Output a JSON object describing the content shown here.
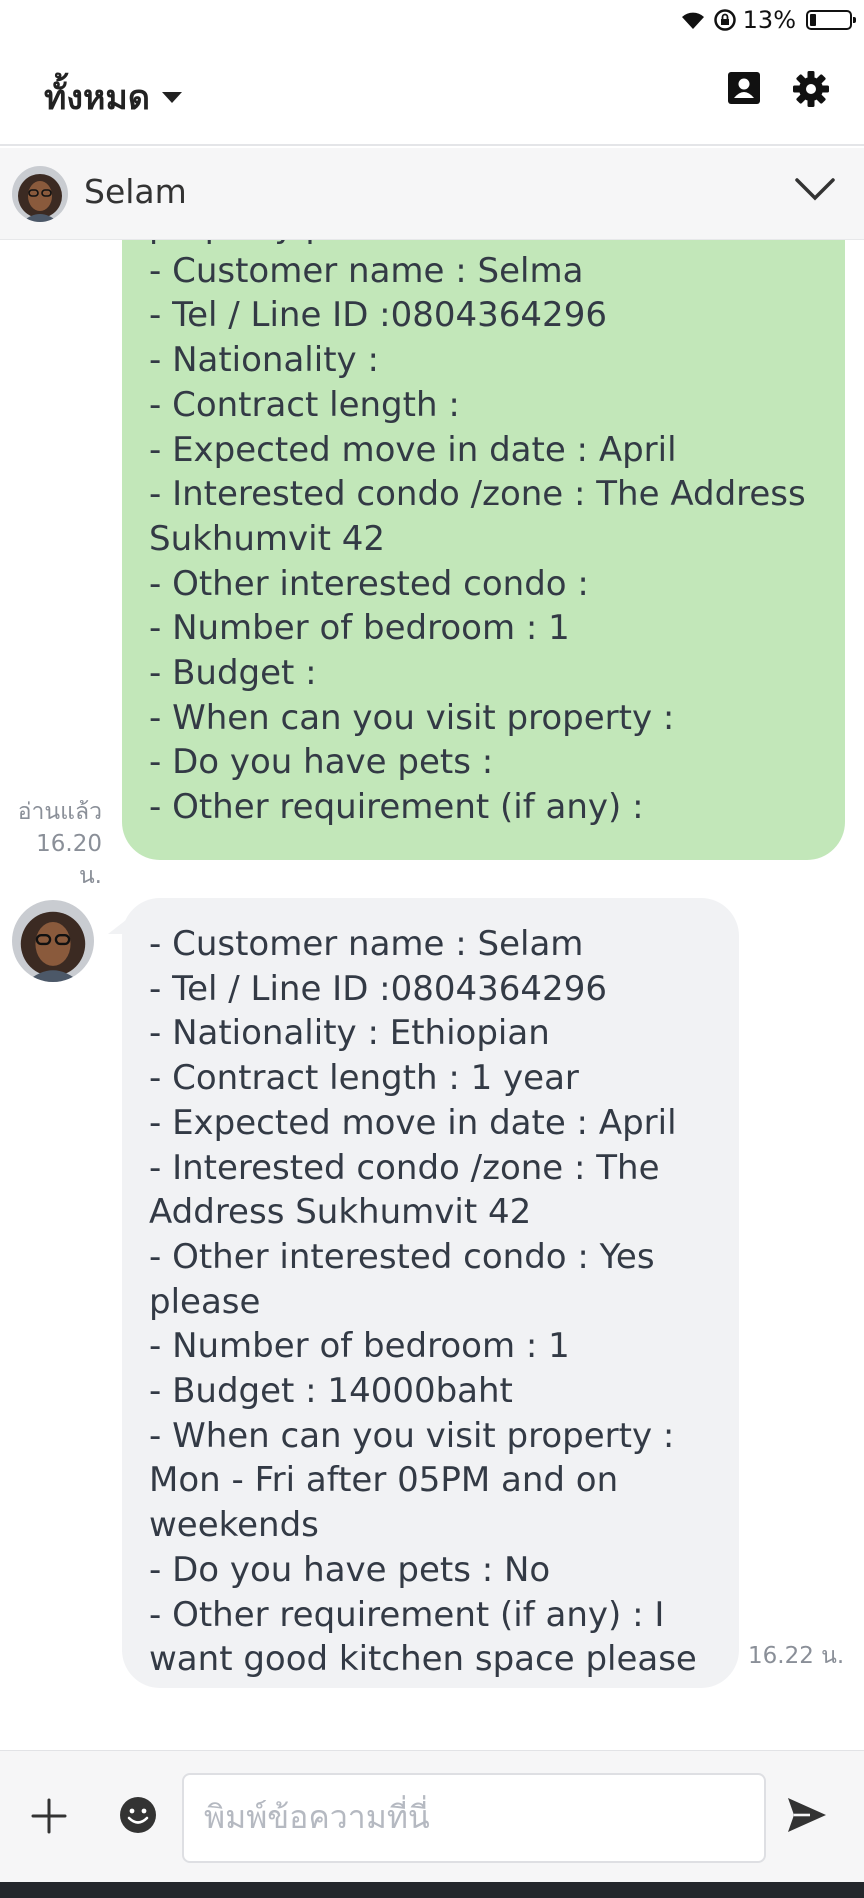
{
  "status_bar": {
    "battery": "13%",
    "icons": [
      "wifi-icon",
      "rotation-lock-icon",
      "battery-icon"
    ]
  },
  "header": {
    "filter_label": "ทั้งหมด",
    "icons": [
      "contact-card-icon",
      "settings-gear-icon"
    ]
  },
  "chat": {
    "contact_name": "Selam"
  },
  "messages": [
    {
      "direction": "outgoing",
      "lines": [
        "property please?",
        "- Customer name : Selma",
        "- Tel / Line ID :0804364296",
        "- Nationality :",
        "- Contract length :",
        "- Expected move in date : April",
        "- Interested condo /zone : The Address Sukhumvit 42",
        "- Other interested condo :",
        "- Number of bedroom  : 1",
        "- Budget :",
        "- When can you visit property :",
        "- Do you have pets :",
        "- Other requirement (if any) :"
      ],
      "read_status": "อ่านแล้ว",
      "time": "16.20 น."
    },
    {
      "direction": "incoming",
      "lines": [
        "- Customer name : Selam",
        "- Tel / Line ID :0804364296",
        "- Nationality : Ethiopian",
        "- Contract length :  1 year",
        "- Expected move in date : April",
        "- Interested condo /zone : The Address Sukhumvit 42",
        "- Other interested condo : Yes please",
        "- Number of bedroom  : 1",
        "- Budget : 14000baht",
        "- When can you visit property : Mon - Fri after 05PM and on weekends",
        "- Do you have pets : No",
        "- Other requirement (if any) : I want good kitchen space please"
      ],
      "time": "16.22 น."
    }
  ],
  "composer": {
    "placeholder": "พิมพ์ข้อความที่นี่",
    "icons": [
      "plus-icon",
      "emoji-icon",
      "send-icon"
    ]
  },
  "colors": {
    "outgoing_bubble": "#c2e7b9",
    "incoming_bubble": "#f1f2f4"
  }
}
